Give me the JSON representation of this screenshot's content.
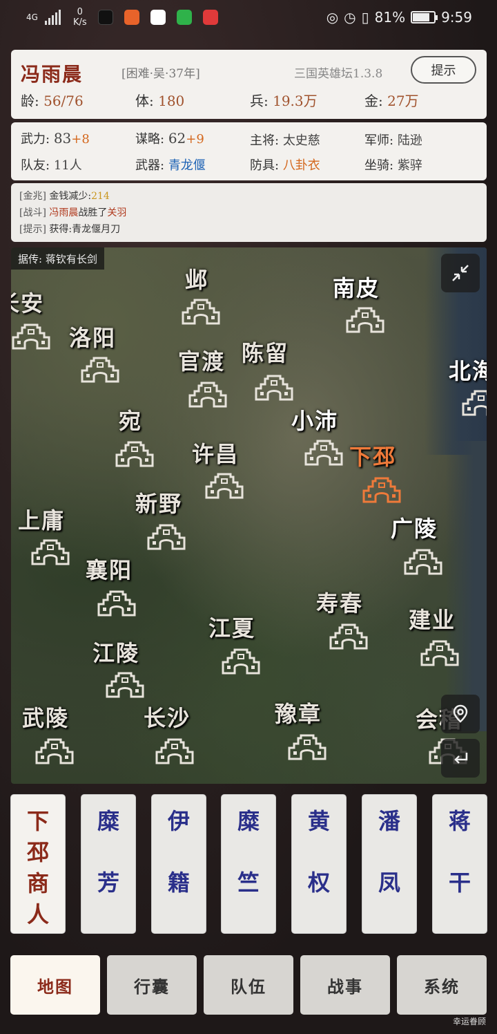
{
  "status_bar": {
    "network": "4G",
    "speed_value": "0",
    "speed_unit": "K/s",
    "battery": "81%",
    "battery_level": 0.81,
    "time": "9:59"
  },
  "character": {
    "name": "冯雨晨",
    "tag": "[困难·吴·37年]",
    "game_title": "三国英雄坛1.3.8",
    "hint_label": "提示"
  },
  "stats_row1": {
    "age_label": "龄:",
    "age_value": "56/76",
    "body_label": "体:",
    "body_value": "180",
    "troops_label": "兵:",
    "troops_value": "19.3万",
    "gold_label": "金:",
    "gold_value": "27万"
  },
  "stats_row2": {
    "force_label": "武力:",
    "force_value": "83",
    "force_bonus": "+8",
    "strategy_label": "谋略:",
    "strategy_value": "62",
    "strategy_bonus": "+9",
    "general_label": "主将:",
    "general_value": "太史慈",
    "advisor_label": "军师:",
    "advisor_value": "陆逊",
    "team_label": "队友:",
    "team_value": "11人",
    "weapon_label": "武器:",
    "weapon_value": "青龙偃",
    "armor_label": "防具:",
    "armor_value": "八卦衣",
    "mount_label": "坐骑:",
    "mount_value": "紫骍"
  },
  "log": [
    {
      "tag": "[金兆]",
      "text": "金钱减少:",
      "value": "214"
    },
    {
      "tag": "[战斗]",
      "actor": "冯雨晨",
      "text": "战胜了",
      "target": "关羽"
    },
    {
      "tag": "[提示]",
      "text": "获得:青龙偃月刀"
    }
  ],
  "map": {
    "legend": "据传: 蒋钦有长剑",
    "highlight_city": "下邳",
    "cities": [
      "长安",
      "邺",
      "南皮",
      "洛阳",
      "官渡",
      "陈留",
      "北海",
      "宛",
      "小沛",
      "许昌",
      "下邳",
      "新野",
      "上庸",
      "广陵",
      "襄阳",
      "寿春",
      "建业",
      "江夏",
      "江陵",
      "武陵",
      "长沙",
      "豫章",
      "会稽"
    ]
  },
  "npcs": [
    {
      "c1": "下",
      "c2": "邳",
      "c3": "商",
      "c4": "人"
    },
    {
      "c1": "糜",
      "c2": "芳"
    },
    {
      "c1": "伊",
      "c2": "籍"
    },
    {
      "c1": "糜",
      "c2": "竺"
    },
    {
      "c1": "黄",
      "c2": "权"
    },
    {
      "c1": "潘",
      "c2": "凤"
    },
    {
      "c1": "蒋",
      "c2": "干"
    }
  ],
  "tabs": [
    "地图",
    "行囊",
    "队伍",
    "战事",
    "系统"
  ],
  "watermark": "幸运眷顾",
  "colors": {
    "accent_red": "#8b2a1a",
    "npc_blue": "#2a2f8a",
    "highlight_orange": "#ef7a3a"
  }
}
